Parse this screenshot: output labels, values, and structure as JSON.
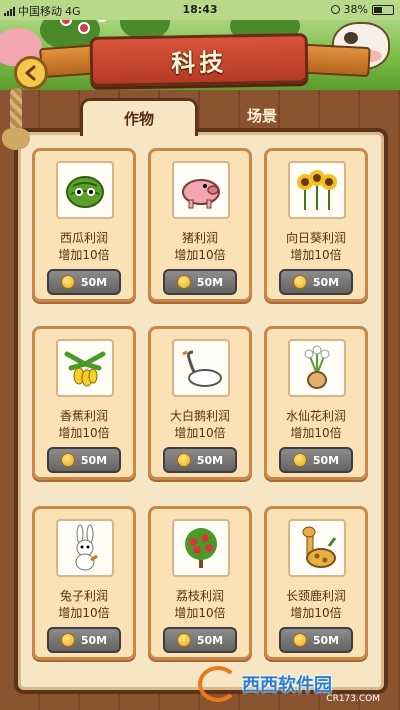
{
  "status_bar": {
    "carrier": "中国移动",
    "network": "4G",
    "time": "18:43",
    "battery": "38%"
  },
  "header": {
    "title": "科技",
    "back_icon": "chevron-left-icon"
  },
  "tabs": [
    {
      "label": "作物",
      "active": true
    },
    {
      "label": "场景",
      "active": false
    }
  ],
  "upgrades": [
    {
      "name": "西瓜利润",
      "bonus": "增加10倍",
      "price": "50M",
      "icon": "watermelon-icon"
    },
    {
      "name": "猪利润",
      "bonus": "增加10倍",
      "price": "50M",
      "icon": "pig-icon"
    },
    {
      "name": "向日葵利润",
      "bonus": "增加10倍",
      "price": "50M",
      "icon": "sunflower-icon"
    },
    {
      "name": "香蕉利润",
      "bonus": "增加10倍",
      "price": "50M",
      "icon": "banana-icon"
    },
    {
      "name": "大白鹅利润",
      "bonus": "增加10倍",
      "price": "50M",
      "icon": "swan-icon"
    },
    {
      "name": "水仙花利润",
      "bonus": "增加10倍",
      "price": "50M",
      "icon": "narcissus-icon"
    },
    {
      "name": "兔子利润",
      "bonus": "增加10倍",
      "price": "50M",
      "icon": "rabbit-icon"
    },
    {
      "name": "荔枝利润",
      "bonus": "增加10倍",
      "price": "50M",
      "icon": "lychee-icon"
    },
    {
      "name": "长颈鹿利润",
      "bonus": "增加10倍",
      "price": "50M",
      "icon": "giraffe-icon"
    }
  ],
  "watermark": {
    "text": "西西软件园",
    "sub": "CR173.COM"
  },
  "colors": {
    "wood": "#8a5430",
    "panel": "#f7e6c6",
    "card": "#fbe1b6",
    "title_board": "#c8452c",
    "button_gray": "#7a7a7a",
    "coin": "#f2c02a"
  }
}
